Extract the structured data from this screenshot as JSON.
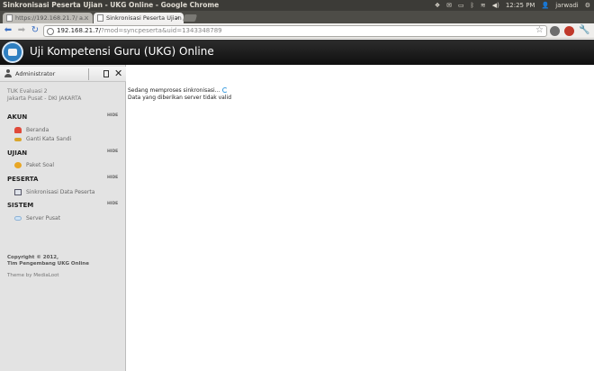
{
  "os_bar": {
    "window_title": "Sinkronisasi Peserta Ujian - UKG Online - Google Chrome",
    "time": "12:25 PM",
    "user": "jarwadi"
  },
  "tabs": [
    {
      "label": "https://192.168.21.7/ a..."
    },
    {
      "label": "Sinkronisasi Peserta Ujian"
    }
  ],
  "toolbar": {
    "url_host": "192.168.21.7/",
    "url_path": "?mod=syncpeserta&uid=1343348789"
  },
  "app": {
    "title": "Uji Kompetensi Guru (UKG) Online"
  },
  "sidebar": {
    "user": "Administrator",
    "tuk_name": "TUK Evaluasi 2",
    "tuk_location": "Jakarta Pusat - DKI JAKARTA",
    "hide_label": "HIDE",
    "sections": [
      {
        "title": "AKUN",
        "items": [
          "Beranda",
          "Ganti Kata Sandi"
        ]
      },
      {
        "title": "UJIAN",
        "items": [
          "Paket Soal"
        ]
      },
      {
        "title": "PESERTA",
        "items": [
          "Sinkronisasi Data Peserta"
        ]
      },
      {
        "title": "SISTEM",
        "items": [
          "Server Pusat"
        ]
      }
    ],
    "copyright": "Copyright © 2012,",
    "team": "Tim Pengembang UKG Online",
    "theme": "Theme by MediaLoot"
  },
  "content": {
    "sync_status": "Sedang memproses sinkronisasi...",
    "error_message": "Data yang diberikan server tidak valid"
  },
  "colors": {
    "header_bg": "#1a1a1a",
    "sidebar_bg": "#e3e3e3",
    "spinner": "#3b9de0"
  }
}
